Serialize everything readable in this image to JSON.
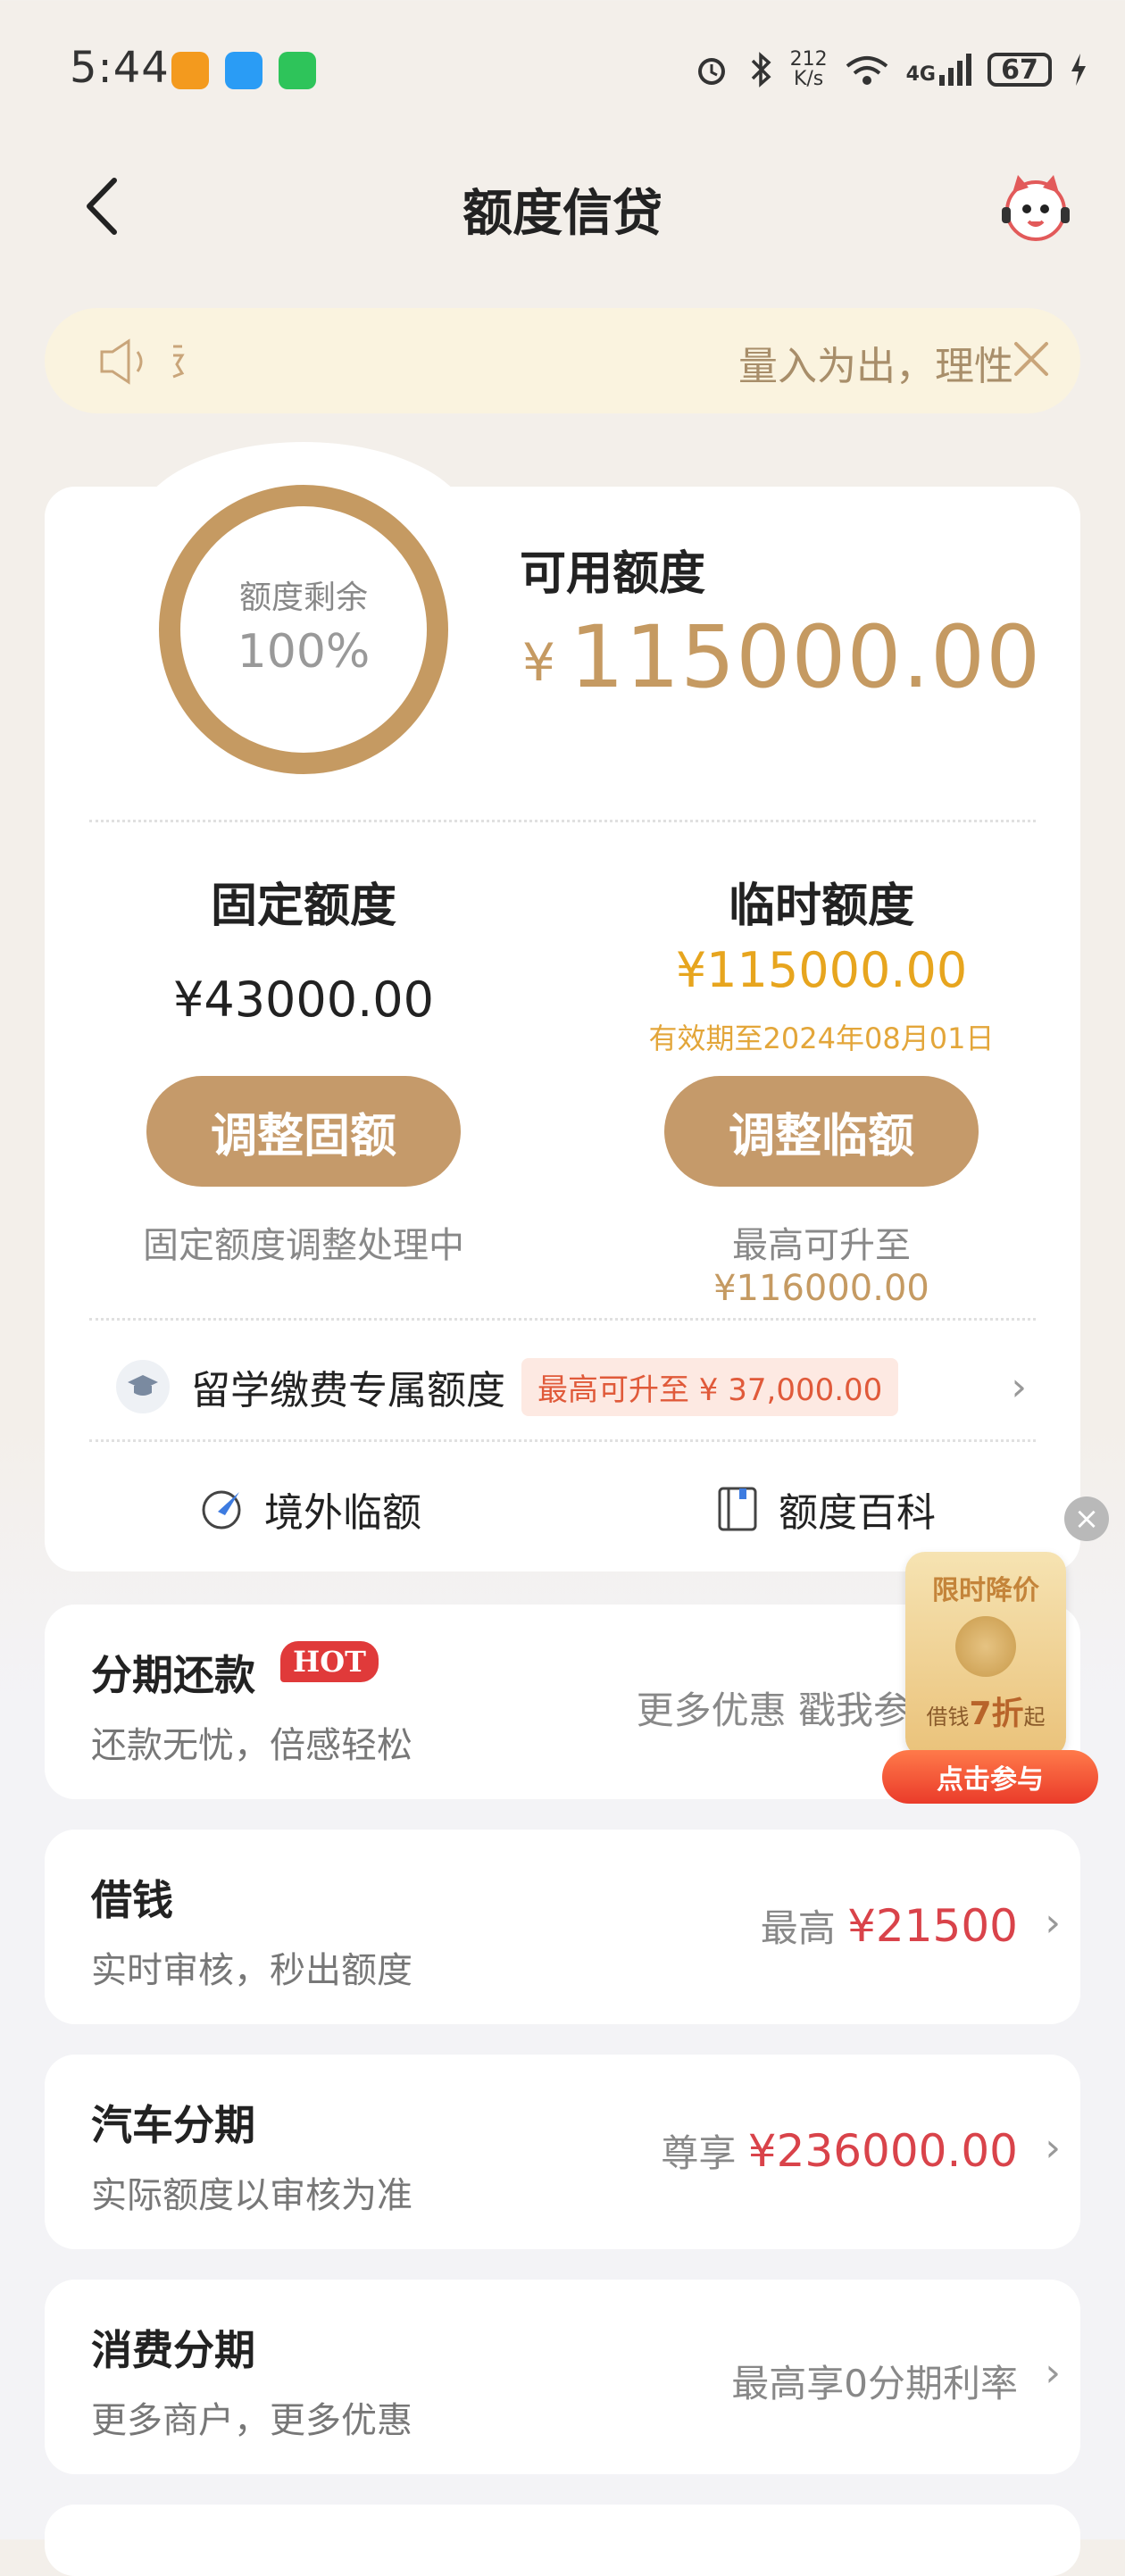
{
  "status_bar": {
    "time": "5:44",
    "net_speed_top": "212",
    "net_speed_unit": "K/s",
    "network": "4G",
    "battery": "67"
  },
  "header": {
    "title": "额度信贷"
  },
  "notice": {
    "text": "量入为出，理性"
  },
  "credit": {
    "ring_label": "额度剩余",
    "ring_percent": "100%",
    "remaining_fraction": 1.0,
    "available_label": "可用额度",
    "available_currency": "¥",
    "available_amount": "115000.00"
  },
  "fixed": {
    "title": "固定额度",
    "amount": "¥43000.00",
    "button": "调整固额",
    "status": "固定额度调整处理中"
  },
  "temporary": {
    "title": "临时额度",
    "amount": "¥115000.00",
    "valid_until": "有效期至2024年08月01日",
    "button": "调整临额",
    "max_prefix": "最高可升至",
    "max_amount": "¥116000.00"
  },
  "study": {
    "label": "留学缴费专属额度",
    "tag": "最高可升至 ¥ 37,000.00"
  },
  "quick_links": [
    {
      "label": "境外临额"
    },
    {
      "label": "额度百科"
    }
  ],
  "rows": [
    {
      "title": "分期还款",
      "badge": "HOT",
      "subtitle": "还款无忧，倍感轻松",
      "right_text": "更多优惠 戳我参"
    },
    {
      "title": "借钱",
      "subtitle": "实时审核，秒出额度",
      "right_prefix": "最高",
      "right_amount": "¥21500"
    },
    {
      "title": "汽车分期",
      "subtitle": "实际额度以审核为准",
      "right_prefix": "尊享",
      "right_amount": "¥236000.00"
    },
    {
      "title": "消费分期",
      "subtitle": "更多商户，更多优惠",
      "right_text": "最高享0分期利率"
    }
  ],
  "promo": {
    "title": "限时降价",
    "sub_prefix": "借钱",
    "sub_value": "7折",
    "sub_suffix": "起",
    "button": "点击参与"
  },
  "colors": {
    "gold": "#c59a62",
    "orange": "#e7a51e",
    "red": "#d9434a"
  }
}
